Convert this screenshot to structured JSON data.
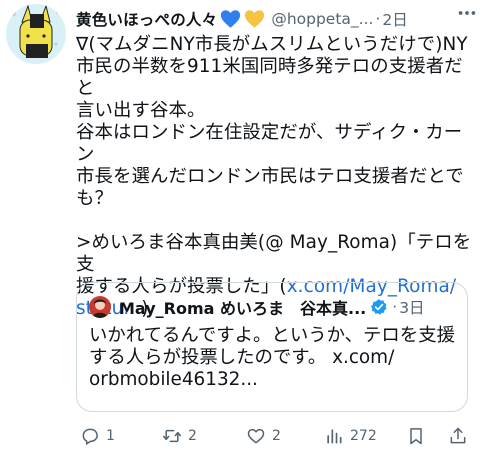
{
  "author": {
    "display_name": "黄色いほっぺの人々",
    "handle": "@hoppeta_...",
    "dot": "·",
    "time": "2日"
  },
  "tweet": {
    "lines_para1": [
      "∇(マムダニNY市長がムスリムというだけで)NY",
      "市民の半数を911米国同時多発テロの支援者だと",
      "言い出す谷本。",
      "谷本はロンドン在住設定だが、サディク・カーン",
      "市長を選んだロンドン市民はテロ支援者だとで",
      "も？"
    ],
    "line_para2_a": ">めいろま谷本真由美(@ May_Roma)「テロを支",
    "line_para2_b": "援する人らが投票した」(",
    "link_part1": "x.com/May_Roma/",
    "link_part2": "statu...",
    "line_para2_end": ")"
  },
  "quote": {
    "name": "May_Roma めいろま　谷本真...",
    "dot": "·",
    "time": "3日",
    "lines": [
      "いかれてるんですよ。というか、テロを支援",
      "する人らが投票したのです。 x.com/",
      "orbmobile46132..."
    ]
  },
  "actions": {
    "reply_count": "1",
    "retweet_count": "2",
    "like_count": "2",
    "view_count": "272"
  },
  "colors": {
    "text": "#0f1419",
    "secondary": "#536471",
    "link": "#1d6fd1",
    "verified": "#1d9bf0",
    "blue_heart": "#2f80ed",
    "yellow_heart": "#f5c542"
  }
}
